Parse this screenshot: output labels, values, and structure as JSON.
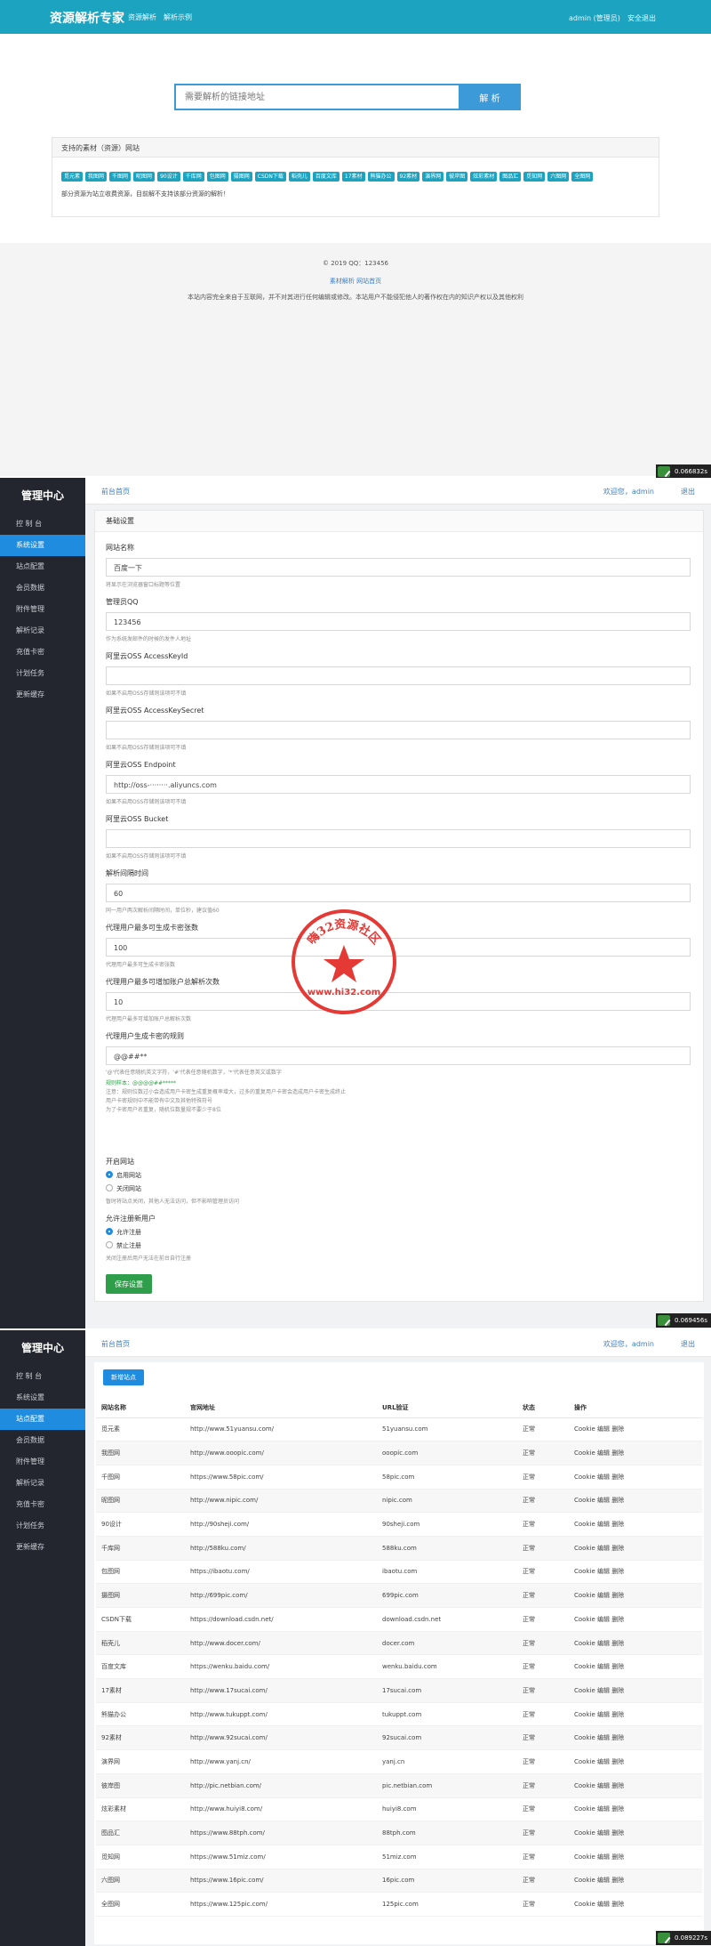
{
  "front": {
    "brand": "资源解析专家",
    "nav": [
      "资源解析",
      "解析示例"
    ],
    "user": "admin (管理员)",
    "logout": "安全退出",
    "search_placeholder": "需要解析的链接地址",
    "search_button": "解 析",
    "panel_title": "支持的素材（资源）网站",
    "tags": [
      "觅元素",
      "我图网",
      "千图网",
      "昵图网",
      "90设计",
      "千库网",
      "包图网",
      "摄图网",
      "CSDN下载",
      "稻壳儿",
      "百度文库",
      "17素材",
      "熊猫办公",
      "92素材",
      "演界网",
      "彼岸图",
      "炫彩素材",
      "图品汇",
      "觅知网",
      "六图网",
      "全图网"
    ],
    "panel_note": "部分资源为站立收费资源，目前解不支持该部分资源的解析！",
    "footer_copy": "© 2019 QQ：123456",
    "footer_links": "素材解析 网站首页",
    "footer_disclaimer": "本站内容完全来自于互联网，并不对其进行任何编辑或修改。本站用户不能侵犯他人的著作权在内的知识产权以及其他权利",
    "time_badge_1": "0.066832s",
    "time_badge_2": "0.069456s",
    "time_badge_3": "0.089227s"
  },
  "admin": {
    "title": "管理中心",
    "menu": [
      "控 制 台",
      "系统设置",
      "站点配置",
      "会员数据",
      "附件管理",
      "解析记录",
      "充值卡密",
      "计划任务",
      "更新缓存"
    ],
    "crumb": "前台首页",
    "welcome": "欢迎您，admin",
    "logout": "退出"
  },
  "settings": {
    "card_title": "基础设置",
    "fields": [
      {
        "label": "网站名称",
        "value": "百度一下",
        "help": "将显示在浏览器窗口标题等位置"
      },
      {
        "label": "管理员QQ",
        "value": "123456",
        "help": "作为系统发邮件的时候的发件人地址"
      },
      {
        "label": "阿里云OSS AccessKeyId",
        "value": "",
        "help": "如果不启用OSS存储则该项可不填"
      },
      {
        "label": "阿里云OSS AccessKeySecret",
        "value": "",
        "help": "如果不启用OSS存储则该项可不填"
      },
      {
        "label": "阿里云OSS Endpoint",
        "value": "http://oss-········.aliyuncs.com",
        "help": "如果不启用OSS存储则该项可不填"
      },
      {
        "label": "阿里云OSS Bucket",
        "value": "",
        "help": "如果不启用OSS存储则该项可不填"
      },
      {
        "label": "解析间隔时间",
        "value": "60",
        "help": "同一用户两次解析间隔时间，单位秒，建议值60"
      },
      {
        "label": "代理用户最多可生成卡密张数",
        "value": "100",
        "help": "代理用户最多可生成卡密张数"
      },
      {
        "label": "代理用户最多可增加账户总解析次数",
        "value": "10",
        "help": "代理用户最多可增加账户总解析次数"
      },
      {
        "label": "代理用户生成卡密的规则",
        "value": "@@##**",
        "help": ""
      }
    ],
    "rule_notes": [
      "'@'代表任意随机英文字符，'#'代表任意随机数字，'*'代表任意英文或数字",
      "规则样本：@@@@##*****",
      "注意：规则位数过小会造成用户卡密生成重复概率增大，过多的重复用户卡密会造成用户卡密生成终止",
      "用户卡密规则中不能带有中文及其他特殊符号",
      "为了卡密用户名重复，随机位数量规不要少于8位"
    ],
    "site_open_label": "开启网站",
    "site_open_options": [
      "启用网站",
      "关闭网站"
    ],
    "site_open_help": "暂时将站点关闭，其他人无法访问，但不影响管理员访问",
    "register_label": "允许注册新用户",
    "register_options": [
      "允许注册",
      "禁止注册"
    ],
    "register_help": "关闭注册后用户无法在前台自行注册",
    "save_button": "保存设置"
  },
  "sites": {
    "add_button": "新增站点",
    "headers": [
      "网站名称",
      "官网地址",
      "URL验证",
      "状态",
      "操作"
    ],
    "rows": [
      [
        "觅元素",
        "http://www.51yuansu.com/",
        "51yuansu.com",
        "正常"
      ],
      [
        "我图网",
        "http://www.ooopic.com/",
        "ooopic.com",
        "正常"
      ],
      [
        "千图网",
        "https://www.58pic.com/",
        "58pic.com",
        "正常"
      ],
      [
        "昵图网",
        "http://www.nipic.com/",
        "nipic.com",
        "正常"
      ],
      [
        "90设计",
        "http://90sheji.com/",
        "90sheji.com",
        "正常"
      ],
      [
        "千库网",
        "http://588ku.com/",
        "588ku.com",
        "正常"
      ],
      [
        "包图网",
        "https://ibaotu.com/",
        "ibaotu.com",
        "正常"
      ],
      [
        "摄图网",
        "http://699pic.com/",
        "699pic.com",
        "正常"
      ],
      [
        "CSDN下载",
        "https://download.csdn.net/",
        "download.csdn.net",
        "正常"
      ],
      [
        "稻壳儿",
        "http://www.docer.com/",
        "docer.com",
        "正常"
      ],
      [
        "百度文库",
        "https://wenku.baidu.com/",
        "wenku.baidu.com",
        "正常"
      ],
      [
        "17素材",
        "http://www.17sucai.com/",
        "17sucai.com",
        "正常"
      ],
      [
        "熊猫办公",
        "http://www.tukuppt.com/",
        "tukuppt.com",
        "正常"
      ],
      [
        "92素材",
        "http://www.92sucai.com/",
        "92sucai.com",
        "正常"
      ],
      [
        "演界网",
        "http://www.yanj.cn/",
        "yanj.cn",
        "正常"
      ],
      [
        "彼岸图",
        "http://pic.netbian.com/",
        "pic.netbian.com",
        "正常"
      ],
      [
        "炫彩素材",
        "http://www.huiyi8.com/",
        "huiyi8.com",
        "正常"
      ],
      [
        "图品汇",
        "https://www.88tph.com/",
        "88tph.com",
        "正常"
      ],
      [
        "觅知网",
        "https://www.51miz.com/",
        "51miz.com",
        "正常"
      ],
      [
        "六图网",
        "https://www.16pic.com/",
        "16pic.com",
        "正常"
      ],
      [
        "全图网",
        "https://www.125pic.com/",
        "125pic.com",
        "正常"
      ]
    ],
    "ops": [
      "Cookie",
      "编辑",
      "删除"
    ]
  },
  "watermark": {
    "top_text": "嗨32资源社区",
    "bottom_text": "www.hi32.com"
  },
  "colors": {
    "front_nav": "#1ba3c0",
    "admin_sidebar": "#23262e",
    "active": "#1f8ce0",
    "save": "#2f9e4a",
    "stamp": "#e53935"
  }
}
